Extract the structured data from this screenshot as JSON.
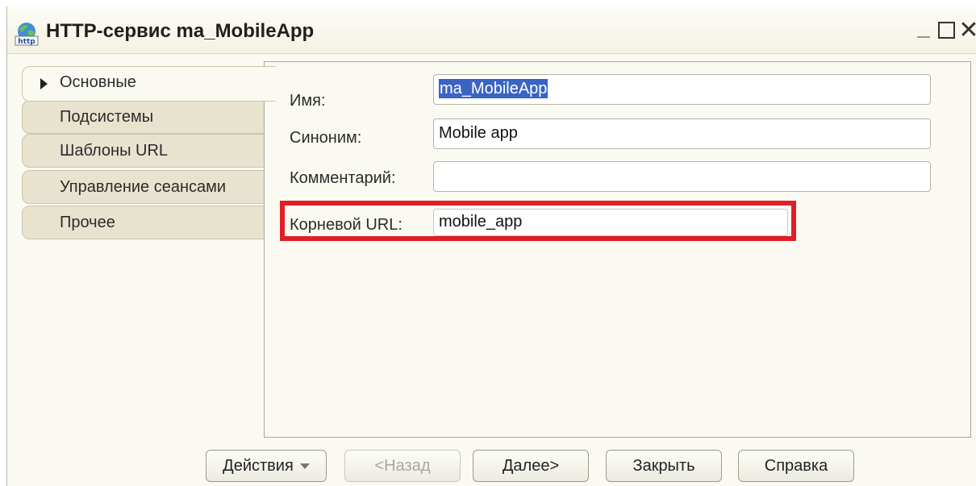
{
  "window": {
    "title": "HTTP-сервис ma_MobileApp",
    "controls": {
      "minimize": "_",
      "close": "✕"
    }
  },
  "tabs": [
    {
      "label": "Основные",
      "active": true
    },
    {
      "label": "Подсистемы"
    },
    {
      "label": "Шаблоны URL"
    },
    {
      "label": "Управление сеансами"
    },
    {
      "label": "Прочее"
    }
  ],
  "form": {
    "name_label": "Имя:",
    "name_value": "ma_MobileApp",
    "synonym_label": "Синоним:",
    "synonym_value": "Mobile app",
    "comment_label": "Комментарий:",
    "comment_value": "",
    "root_url_label": "Корневой URL:",
    "root_url_value": "mobile_app"
  },
  "buttons": {
    "actions": "Действия",
    "back": "<Назад",
    "next": "Далее>",
    "close": "Закрыть",
    "help": "Справка"
  },
  "colors": {
    "highlight": "#e01f26",
    "selection": "#3a64c4"
  }
}
